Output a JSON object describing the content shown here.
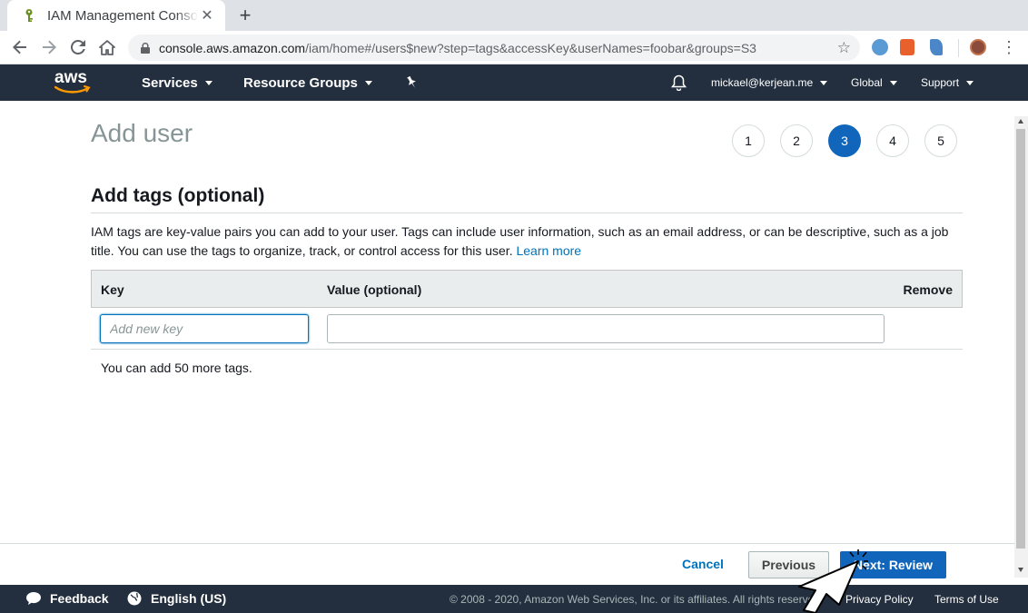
{
  "browser": {
    "tab_title": "IAM Management Console",
    "url_host": "console.aws.amazon.com",
    "url_path": "/iam/home#/users$new?step=tags&accessKey&userNames=foobar&groups=S3"
  },
  "awsnav": {
    "logo_text": "aws",
    "services_label": "Services",
    "resource_groups_label": "Resource Groups",
    "account_label": "mickael@kerjean.me",
    "region_label": "Global",
    "support_label": "Support"
  },
  "page": {
    "title": "Add user",
    "steps": [
      "1",
      "2",
      "3",
      "4",
      "5"
    ],
    "active_step": "3"
  },
  "tags_section": {
    "title": "Add tags (optional)",
    "description": "IAM tags are key-value pairs you can add to your user. Tags can include user information, such as an email address, or can be descriptive, such as a job title. You can use the tags to organize, track, or control access for this user.",
    "learn_more": "Learn more",
    "columns": {
      "key": "Key",
      "value": "Value (optional)",
      "remove": "Remove"
    },
    "key_placeholder": "Add new key",
    "key_value": "",
    "value_value": "",
    "remaining_text": "You can add 50 more tags."
  },
  "actions": {
    "cancel_label": "Cancel",
    "previous_label": "Previous",
    "next_label": "Next: Review"
  },
  "footer": {
    "feedback_label": "Feedback",
    "language_label": "English (US)",
    "copyright": "© 2008 - 2020, Amazon Web Services, Inc. or its affiliates. All rights reserved.",
    "privacy_label": "Privacy Policy",
    "terms_label": "Terms of Use"
  },
  "colors": {
    "aws_nav_bg": "#232f3e",
    "primary_blue": "#1166bb",
    "link_blue": "#0073bb",
    "aws_orange": "#ff9900"
  }
}
